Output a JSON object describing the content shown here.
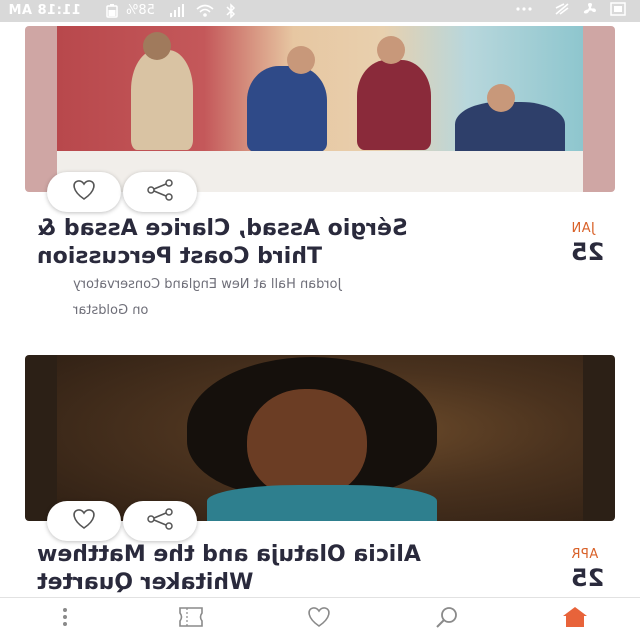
{
  "status_bar": {
    "time": "11:18 AM",
    "battery": "58%",
    "icons": [
      "bluetooth-icon",
      "wifi-icon",
      "signal-icon",
      "battery-icon",
      "more-icon",
      "cast-icon",
      "fan-icon",
      "screenshot-icon"
    ]
  },
  "events": [
    {
      "month": "JAN",
      "day": "25",
      "title_line1": "Sérgio Assad, Clarice Assad &",
      "title_line2": "Third Coast Percussion",
      "venue_line1": "Jordan Hall at New England Conservatory",
      "venue_line2": "on Goldstar",
      "favorite_icon": "heart-icon",
      "share_icon": "share-icon"
    },
    {
      "month": "APR",
      "day": "25",
      "title_line1": "Alicia Olatuja and the Matthew",
      "title_line2": "Whitaker Quartet",
      "favorite_icon": "heart-icon",
      "share_icon": "share-icon"
    }
  ],
  "bottom_nav": {
    "items": [
      {
        "name": "more-icon",
        "active": false
      },
      {
        "name": "tickets-icon",
        "active": false
      },
      {
        "name": "heart-icon",
        "active": false
      },
      {
        "name": "search-icon",
        "active": false
      },
      {
        "name": "home-icon",
        "active": true
      }
    ],
    "accent": "#e8633a",
    "inactive": "#8a8a8a"
  },
  "colors": {
    "title": "#2a2a3c",
    "month": "#d9622a",
    "venue": "#6e6e78"
  }
}
